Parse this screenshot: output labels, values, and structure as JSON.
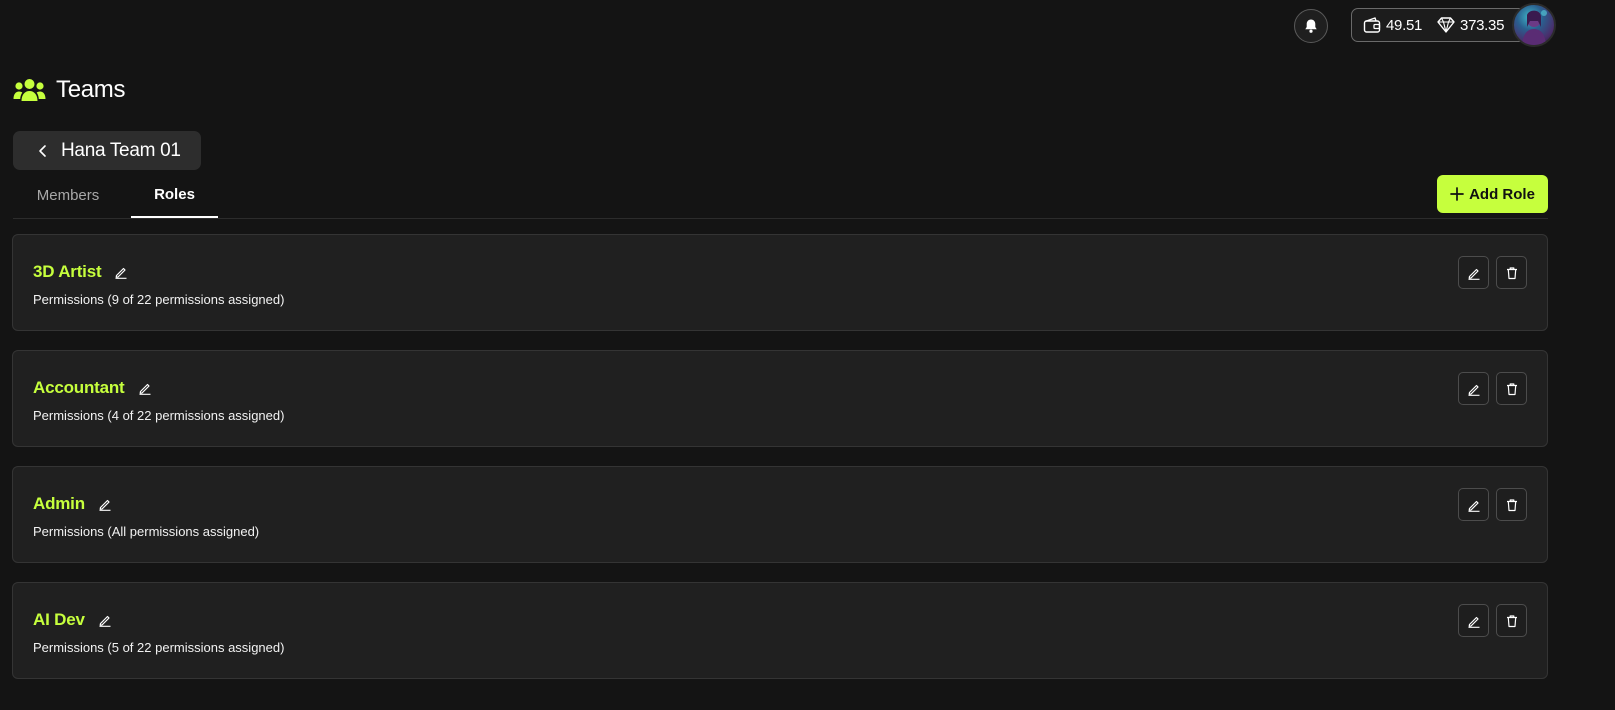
{
  "header": {
    "wallet_balance": "49.51",
    "gem_balance": "373.35"
  },
  "page": {
    "title": "Teams"
  },
  "team": {
    "name": "Hana Team 01"
  },
  "tabs": [
    {
      "label": "Members",
      "active": false
    },
    {
      "label": "Roles",
      "active": true
    }
  ],
  "actions": {
    "add_role_label": "Add Role"
  },
  "roles": [
    {
      "name": "3D Artist",
      "permissions": "Permissions (9 of 22 permissions assigned)"
    },
    {
      "name": "Accountant",
      "permissions": "Permissions (4 of 22 permissions assigned)"
    },
    {
      "name": "Admin",
      "permissions": "Permissions (All permissions assigned)"
    },
    {
      "name": "AI Dev",
      "permissions": "Permissions (5 of 22 permissions assigned)"
    }
  ],
  "colors": {
    "accent": "#c6ff3d",
    "background": "#141414",
    "card": "#202020"
  }
}
